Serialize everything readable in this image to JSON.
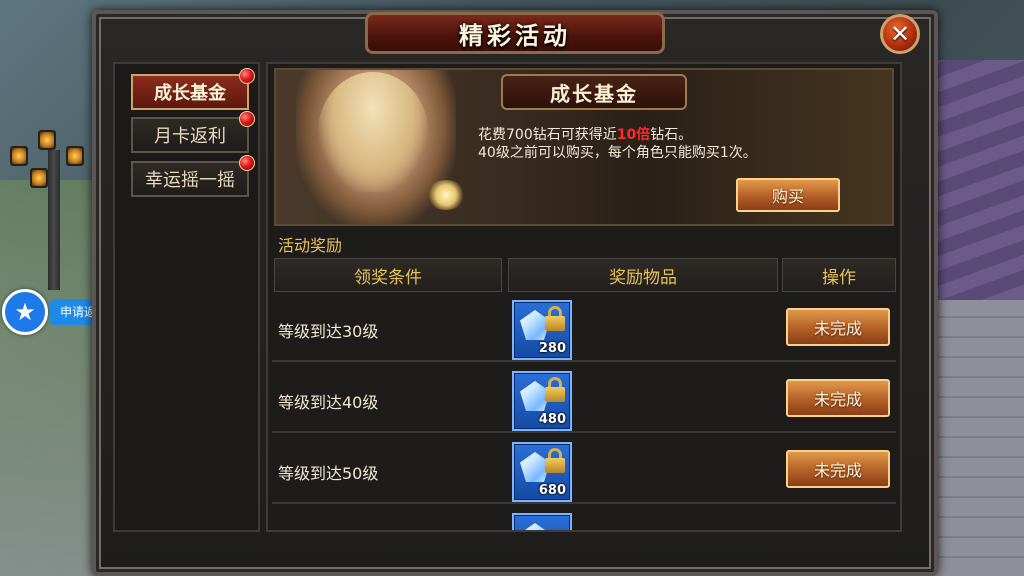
{
  "window": {
    "title": "精彩活动",
    "close_symbol": "✕"
  },
  "helper": {
    "label": "申请返利",
    "icon": "star-icon"
  },
  "sidebar": {
    "items": [
      {
        "label": "成长基金",
        "active": true,
        "badge": true
      },
      {
        "label": "月卡返利",
        "active": false,
        "badge": true
      },
      {
        "label": "幸运摇一摇",
        "active": false,
        "badge": true
      }
    ]
  },
  "banner": {
    "title": "成长基金",
    "desc_line1_prefix": "花费700钻石可获得近",
    "desc_line1_highlight": "10倍",
    "desc_line1_suffix": "钻石。",
    "desc_line2": "40级之前可以购买，每个角色只能购买1次。",
    "buy_label": "购买"
  },
  "rewards": {
    "section_title": "活动奖励",
    "columns": [
      "领奖条件",
      "奖励物品",
      "操作"
    ],
    "rows": [
      {
        "condition": "等级到达30级",
        "item_qty": "280",
        "action": "未完成"
      },
      {
        "condition": "等级到达40级",
        "item_qty": "480",
        "action": "未完成"
      },
      {
        "condition": "等级到达50级",
        "item_qty": "680",
        "action": "未完成"
      }
    ]
  },
  "colors": {
    "accent_gold": "#e8c15a",
    "highlight_red": "#ff2a2a",
    "button_orange": "#b8642a",
    "reward_blue": "#2a6fd8"
  }
}
